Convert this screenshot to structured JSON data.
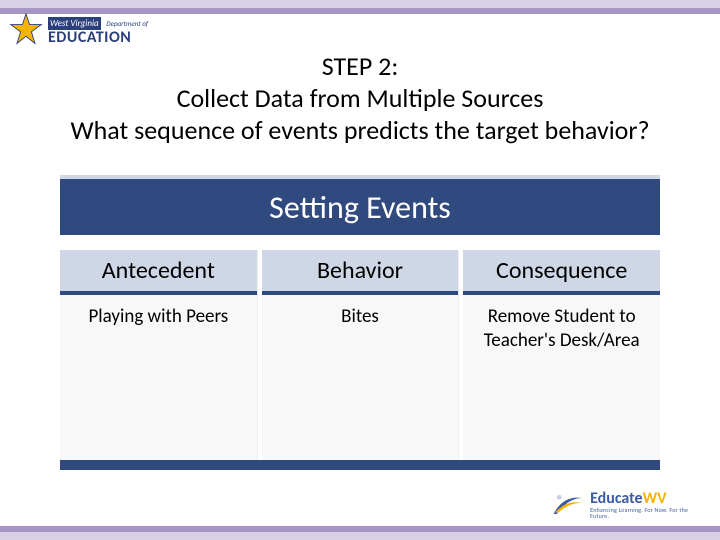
{
  "logo_wv": {
    "line1": "West Virginia",
    "line1b": "Department of",
    "line2": "EDUCATION"
  },
  "title": {
    "step": "STEP 2:",
    "main": "Collect Data from Multiple Sources",
    "sub": "What sequence of events predicts the target behavior?"
  },
  "setting_bar": "Setting Events",
  "columns": [
    {
      "head": "Antecedent",
      "body": "Playing with Peers"
    },
    {
      "head": "Behavior",
      "body": "Bites"
    },
    {
      "head": "Consequence",
      "body": "Remove Student to Teacher's Desk/Area"
    }
  ],
  "logo_edu": {
    "part1": "Educate",
    "part2": "WV",
    "tag": "Enhancing Learning. For Now. For the Future."
  },
  "colors": {
    "brand_navy": "#2b3f7a",
    "panel_navy": "#30497f",
    "panel_header": "#cfd6e5",
    "band_outer": "#d7d0e6",
    "band_inner": "#a696c6",
    "accent_gold": "#f4b400"
  }
}
